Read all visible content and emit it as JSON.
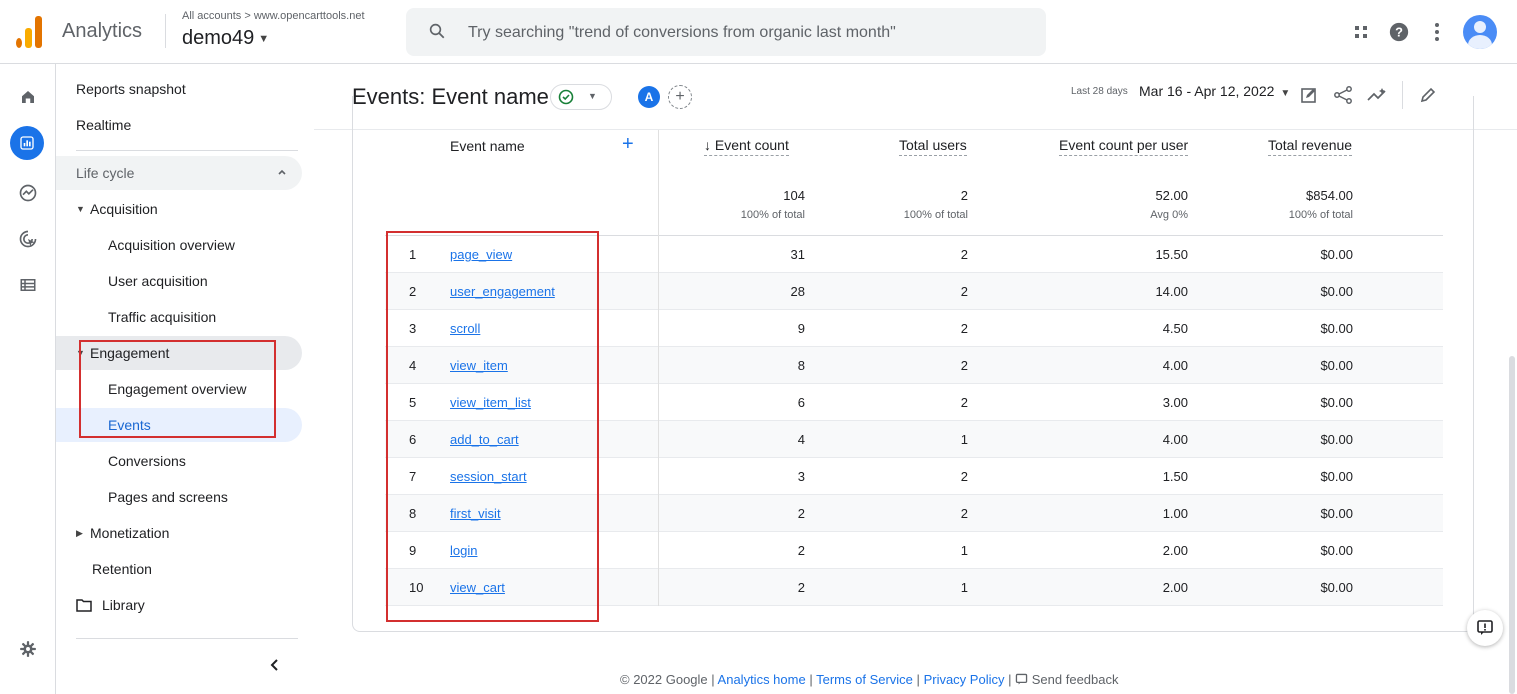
{
  "topbar": {
    "app_name": "Analytics",
    "breadcrumb": "All accounts > www.opencarttools.net",
    "account": "demo49",
    "search_placeholder": "Try searching \"trend of conversions from organic last month\""
  },
  "nav": {
    "reports_snapshot": "Reports snapshot",
    "realtime": "Realtime",
    "lifecycle": "Life cycle",
    "acquisition": "Acquisition",
    "acquisition_overview": "Acquisition overview",
    "user_acquisition": "User acquisition",
    "traffic_acquisition": "Traffic acquisition",
    "engagement": "Engagement",
    "engagement_overview": "Engagement overview",
    "events": "Events",
    "conversions": "Conversions",
    "pages_and_screens": "Pages and screens",
    "monetization": "Monetization",
    "retention": "Retention",
    "library": "Library"
  },
  "header": {
    "title": "Events: Event name",
    "compare_badge": "A",
    "date_label": "Last 28 days",
    "date_range": "Mar 16 - Apr 12, 2022"
  },
  "table": {
    "columns": {
      "event_name": "Event name",
      "event_count": "↓ Event count",
      "total_users": "Total users",
      "per_user": "Event count per user",
      "revenue": "Total revenue"
    },
    "totals": {
      "event_count": "104",
      "event_count_sub": "100% of total",
      "total_users": "2",
      "total_users_sub": "100% of total",
      "per_user": "52.00",
      "per_user_sub": "Avg 0%",
      "revenue": "$854.00",
      "revenue_sub": "100% of total"
    },
    "rows": [
      {
        "rank": "1",
        "name": "page_view",
        "count": "31",
        "users": "2",
        "per_user": "15.50",
        "revenue": "$0.00"
      },
      {
        "rank": "2",
        "name": "user_engagement",
        "count": "28",
        "users": "2",
        "per_user": "14.00",
        "revenue": "$0.00"
      },
      {
        "rank": "3",
        "name": "scroll",
        "count": "9",
        "users": "2",
        "per_user": "4.50",
        "revenue": "$0.00"
      },
      {
        "rank": "4",
        "name": "view_item",
        "count": "8",
        "users": "2",
        "per_user": "4.00",
        "revenue": "$0.00"
      },
      {
        "rank": "5",
        "name": "view_item_list",
        "count": "6",
        "users": "2",
        "per_user": "3.00",
        "revenue": "$0.00"
      },
      {
        "rank": "6",
        "name": "add_to_cart",
        "count": "4",
        "users": "1",
        "per_user": "4.00",
        "revenue": "$0.00"
      },
      {
        "rank": "7",
        "name": "session_start",
        "count": "3",
        "users": "2",
        "per_user": "1.50",
        "revenue": "$0.00"
      },
      {
        "rank": "8",
        "name": "first_visit",
        "count": "2",
        "users": "2",
        "per_user": "1.00",
        "revenue": "$0.00"
      },
      {
        "rank": "9",
        "name": "login",
        "count": "2",
        "users": "1",
        "per_user": "2.00",
        "revenue": "$0.00"
      },
      {
        "rank": "10",
        "name": "view_cart",
        "count": "2",
        "users": "1",
        "per_user": "2.00",
        "revenue": "$0.00"
      }
    ]
  },
  "footer": {
    "copyright": "© 2022 Google |",
    "analytics_home": "Analytics home",
    "terms": "Terms of Service",
    "privacy": "Privacy Policy",
    "sep": "|",
    "feedback": "Send feedback"
  },
  "colors": {
    "accent": "#1a73e8",
    "highlight": "#d32f2f",
    "active_nav_bg": "#e8f0fe"
  },
  "icons": [
    "analytics-logo-icon",
    "search-icon",
    "apps-grid-icon",
    "help-icon",
    "more-vert-icon",
    "account-avatar-icon",
    "home-icon",
    "reports-icon",
    "explore-icon",
    "advertising-icon",
    "configure-icon",
    "settings-icon",
    "collapse-icon",
    "folder-icon",
    "check-circle-icon",
    "customize-report-icon",
    "share-icon",
    "insights-icon",
    "edit-icon",
    "feedback-icon"
  ]
}
